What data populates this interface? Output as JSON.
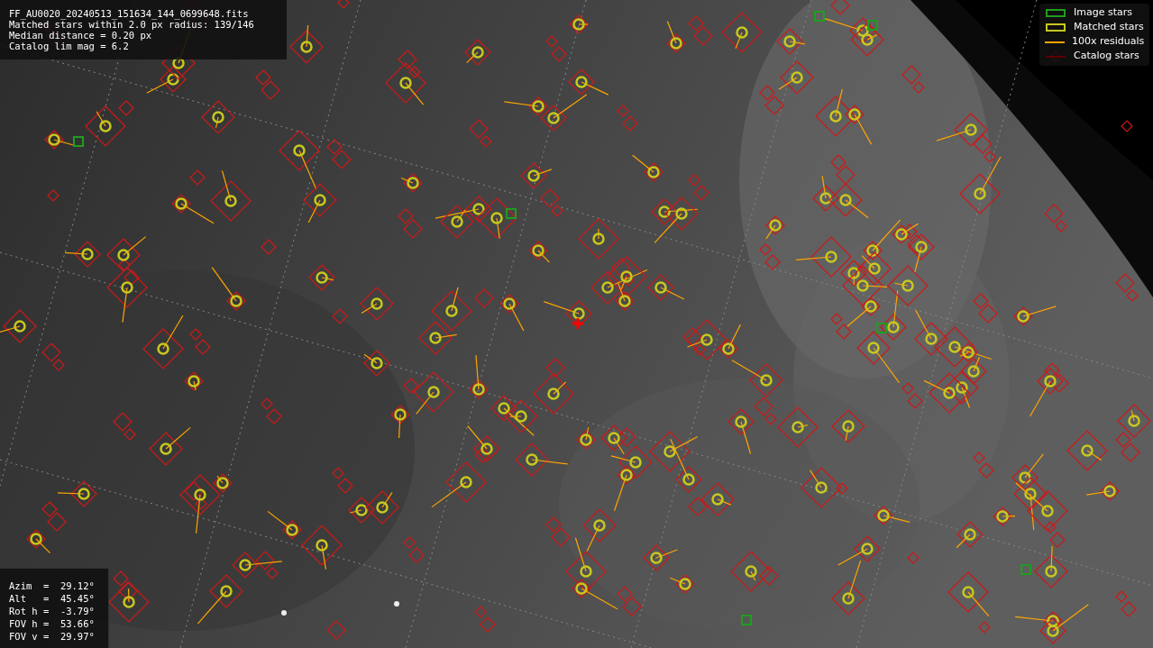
{
  "info_panel": {
    "lines": [
      "FF_AU0020_20240513_151634_144_0699648.fits",
      "Matched stars within 2.0 px radius: 139/146",
      "Median distance = 0.20 px",
      "Catalog lim mag = 6.2"
    ]
  },
  "legend": {
    "items": [
      {
        "label": "Image stars",
        "kind": "box",
        "color": "#1f9d1f"
      },
      {
        "label": "Matched stars",
        "kind": "box",
        "color": "#c8c81e"
      },
      {
        "label": "100x residuals",
        "kind": "line",
        "color": "#ffa500"
      },
      {
        "label": "Catalog stars",
        "kind": "blank",
        "color": "#5a0000"
      }
    ]
  },
  "pointing_panel": {
    "lines": [
      "Azim  =  29.12°",
      "Alt   =  45.45°",
      "Rot h =  -3.79°",
      "FOV h =  53.66°",
      "FOV v =  29.97°"
    ]
  }
}
